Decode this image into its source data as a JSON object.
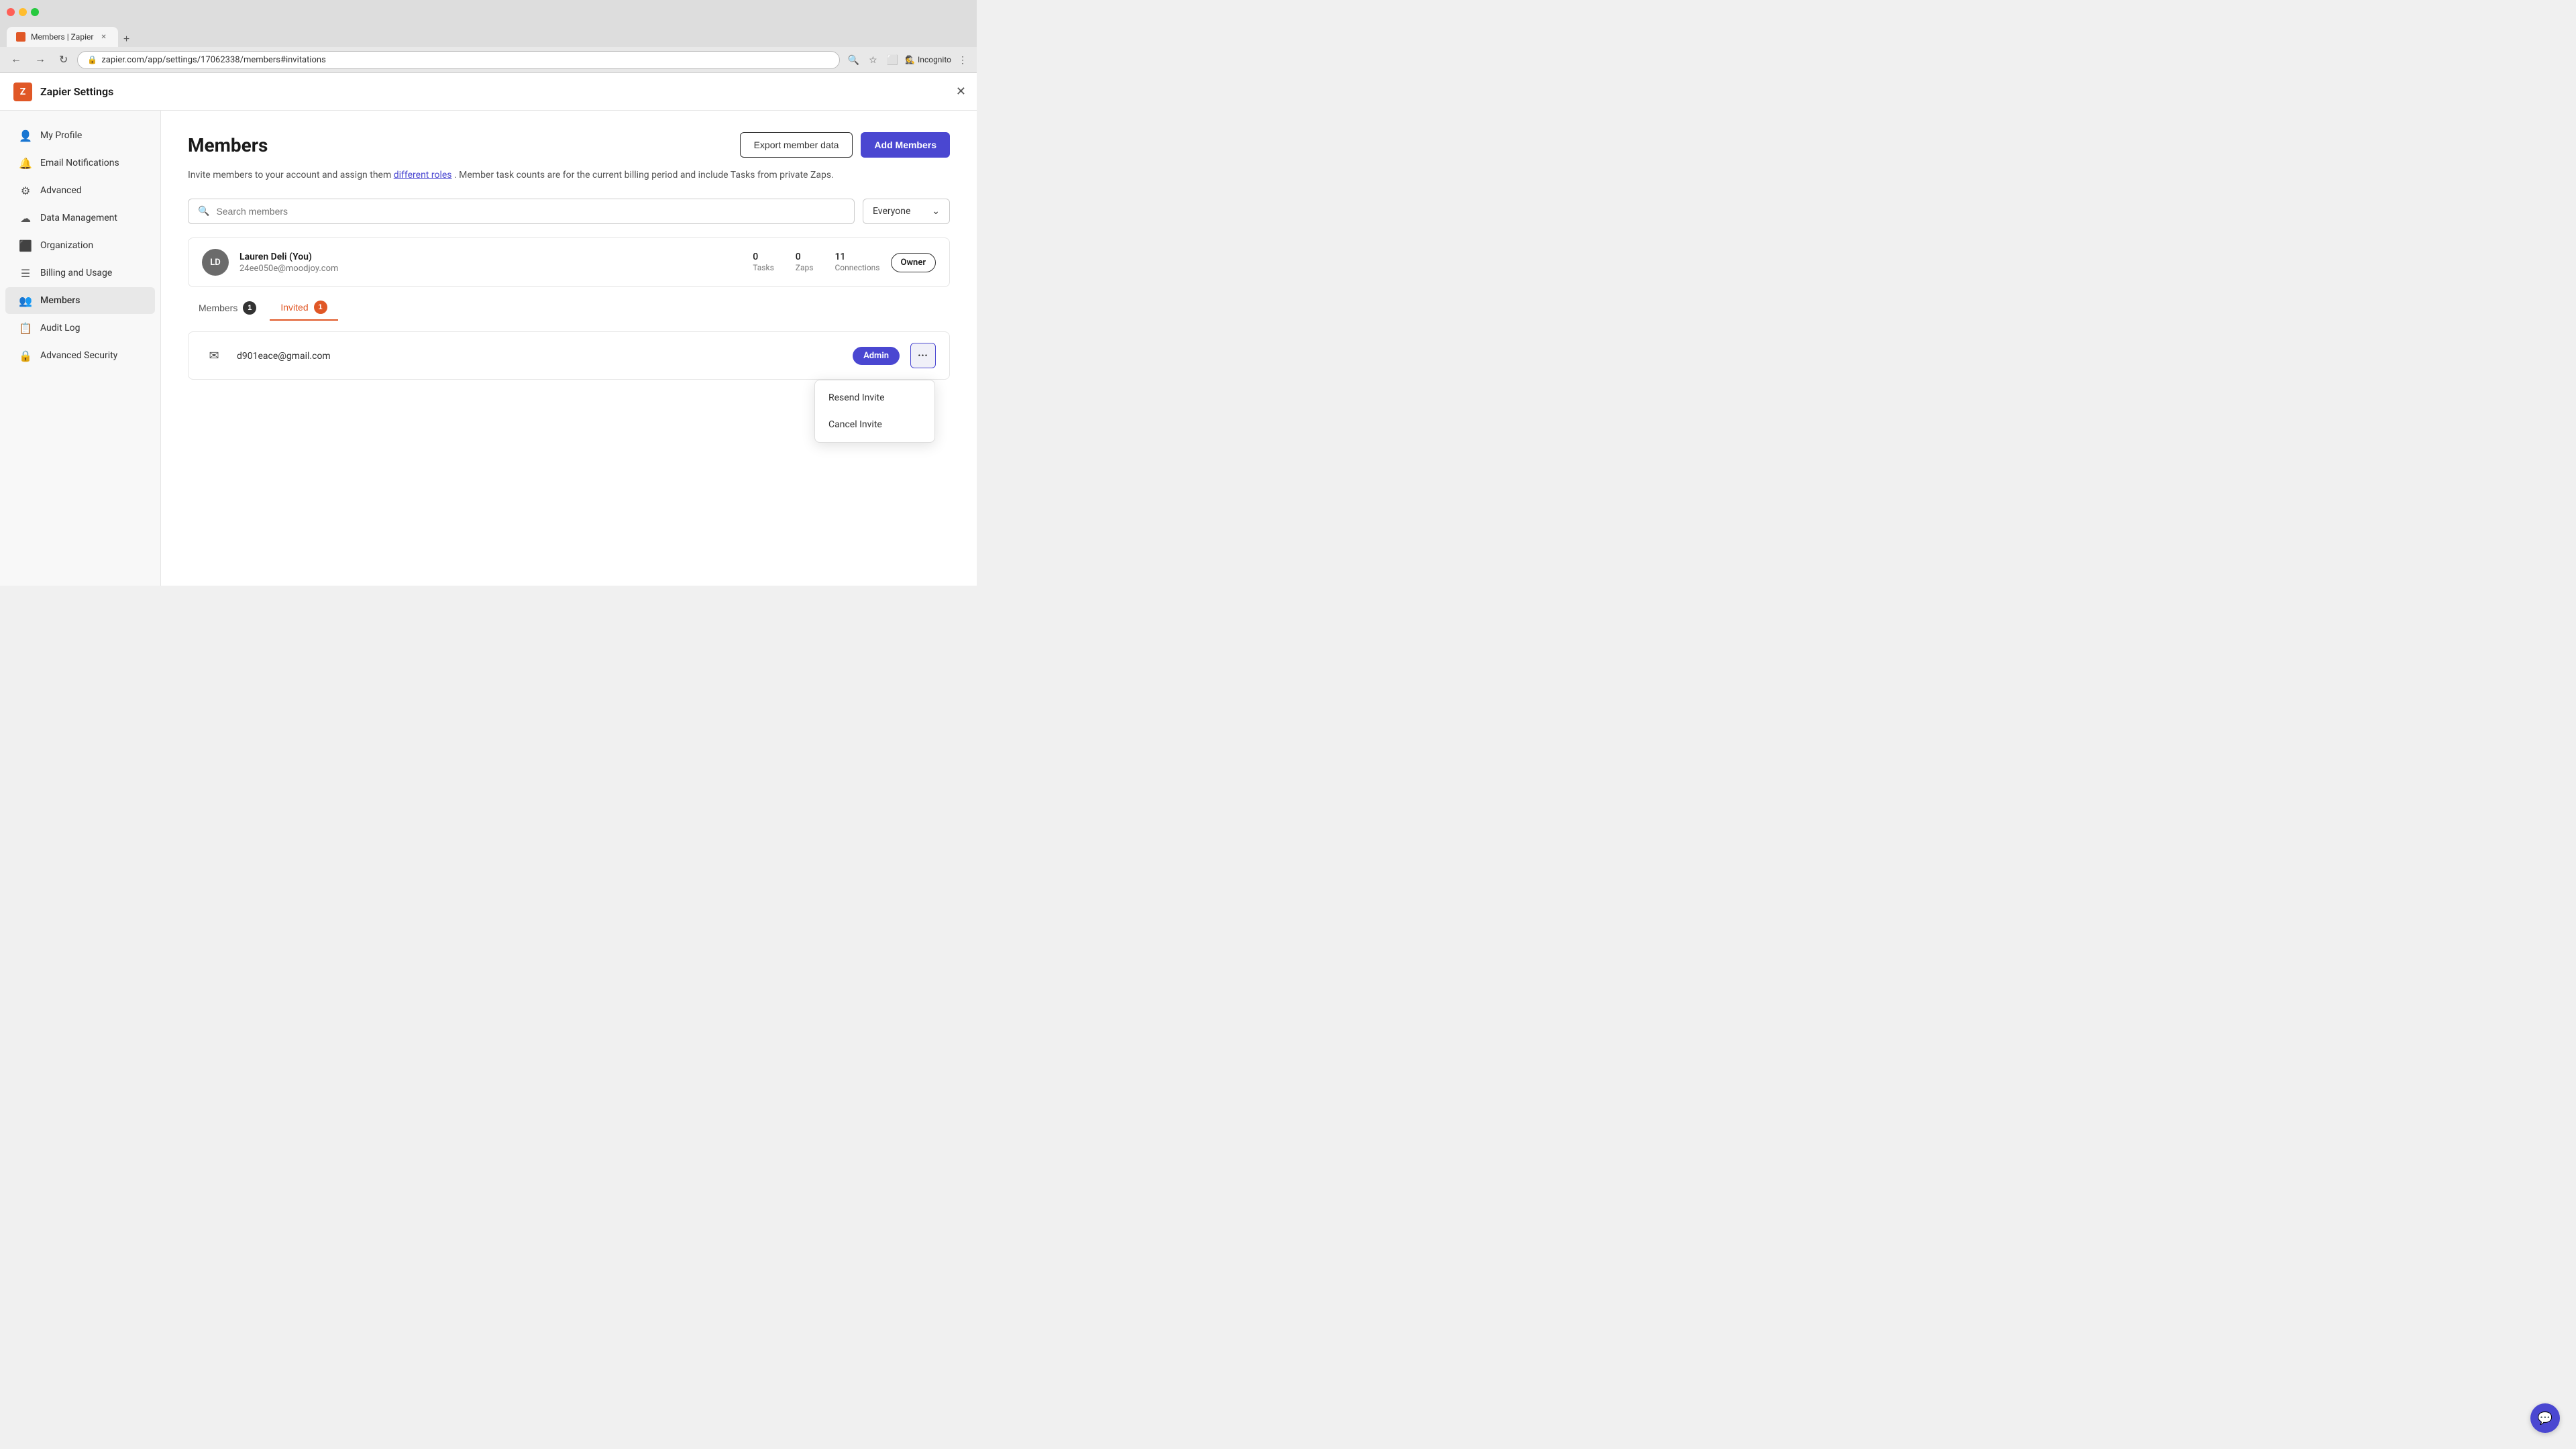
{
  "browser": {
    "tab_title": "Members | Zapier",
    "url": "zapier.com/app/settings/17062338/members#invitations",
    "incognito_label": "Incognito"
  },
  "app": {
    "title": "Zapier Settings",
    "logo_text": "Z"
  },
  "sidebar": {
    "items": [
      {
        "id": "my-profile",
        "label": "My Profile",
        "icon": "👤"
      },
      {
        "id": "email-notifications",
        "label": "Email Notifications",
        "icon": "🔔"
      },
      {
        "id": "advanced",
        "label": "Advanced",
        "icon": "⚙"
      },
      {
        "id": "data-management",
        "label": "Data Management",
        "icon": "☁"
      },
      {
        "id": "organization",
        "label": "Organization",
        "icon": "⬛"
      },
      {
        "id": "billing-and-usage",
        "label": "Billing and Usage",
        "icon": "☰"
      },
      {
        "id": "members",
        "label": "Members",
        "icon": "👥",
        "active": true
      },
      {
        "id": "audit-log",
        "label": "Audit Log",
        "icon": "📋"
      },
      {
        "id": "advanced-security",
        "label": "Advanced Security",
        "icon": "🔒"
      }
    ]
  },
  "main": {
    "page_title": "Members",
    "export_btn": "Export member data",
    "add_members_btn": "Add Members",
    "description": "Invite members to your account and assign them",
    "description_link": "different roles",
    "description_suffix": ". Member task counts are for the current billing period and include Tasks from private Zaps.",
    "search_placeholder": "Search members",
    "filter_value": "Everyone",
    "owner_row": {
      "initials": "LD",
      "name": "Lauren Deli (You)",
      "email": "24ee050e@moodjoy.com",
      "tasks": "0",
      "tasks_label": "Tasks",
      "zaps": "0",
      "zaps_label": "Zaps",
      "connections": "11",
      "connections_label": "Connections",
      "role": "Owner"
    },
    "tabs": [
      {
        "id": "members",
        "label": "Members",
        "count": "1",
        "active": false
      },
      {
        "id": "invited",
        "label": "Invited",
        "count": "1",
        "active": true
      }
    ],
    "invited_row": {
      "email": "d901eace@gmail.com",
      "role": "Admin"
    },
    "dropdown": {
      "items": [
        {
          "id": "resend",
          "label": "Resend Invite"
        },
        {
          "id": "cancel",
          "label": "Cancel Invite"
        }
      ]
    }
  },
  "icons": {
    "search": "🔍",
    "chevron": "⌃",
    "more": "•••",
    "support": "💬",
    "email_icon": "✉",
    "close": "✕"
  }
}
